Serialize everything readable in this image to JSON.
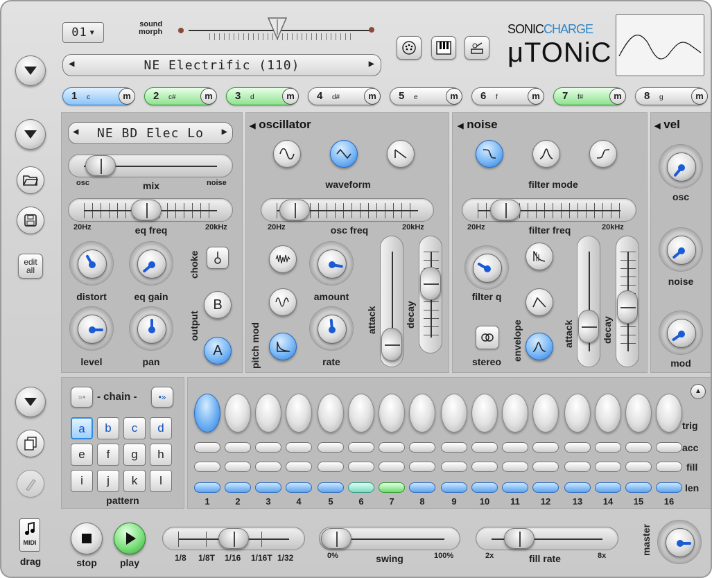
{
  "header": {
    "program": "01",
    "sound_morph": "sound\nmorph",
    "preset": "NE Electrific (110)",
    "brand_top": "SONICCHARGE",
    "brand_sonic": "SONIC",
    "brand_charge": "CHARGE",
    "brand_main": "μTONiC"
  },
  "channels": [
    {
      "num": "1",
      "note": "c",
      "state": "blue"
    },
    {
      "num": "2",
      "note": "c#",
      "state": "green"
    },
    {
      "num": "3",
      "note": "d",
      "state": "green"
    },
    {
      "num": "4",
      "note": "d#",
      "state": "off"
    },
    {
      "num": "5",
      "note": "e",
      "state": "off"
    },
    {
      "num": "6",
      "note": "f",
      "state": "off"
    },
    {
      "num": "7",
      "note": "f#",
      "state": "green"
    },
    {
      "num": "8",
      "note": "g",
      "state": "off"
    }
  ],
  "mute_label": "m",
  "patch": {
    "name": "NE BD Elec Lo",
    "osc": "osc",
    "mix": "mix",
    "noise": "noise",
    "f20": "20Hz",
    "eq_freq": "eq freq",
    "f20k": "20kHz",
    "distort": "distort",
    "eq_gain": "eq gain",
    "choke": "choke",
    "level": "level",
    "pan": "pan",
    "output": "output",
    "out_b": "B",
    "out_a": "A",
    "edit_all": "edit\nall"
  },
  "oscillator": {
    "title": "oscillator",
    "waveform": "waveform",
    "f20": "20Hz",
    "osc_freq": "osc freq",
    "f20k": "20kHz",
    "pitch_mod": "pitch mod",
    "amount": "amount",
    "rate": "rate",
    "attack": "attack",
    "decay": "decay"
  },
  "noise": {
    "title": "noise",
    "filter_mode": "filter mode",
    "f20": "20Hz",
    "filter_freq": "filter freq",
    "f20k": "20kHz",
    "filter_q": "filter q",
    "envelope": "envelope",
    "stereo": "stereo",
    "attack": "attack",
    "decay": "decay"
  },
  "vel": {
    "title": "vel",
    "osc": "osc",
    "noise": "noise",
    "mod": "mod"
  },
  "pattern": {
    "chain": "- chain -",
    "label": "pattern",
    "letters": [
      "a",
      "b",
      "c",
      "d",
      "e",
      "f",
      "g",
      "h",
      "i",
      "j",
      "k",
      "l"
    ],
    "selected": "a"
  },
  "steps": {
    "numbers": [
      "1",
      "2",
      "3",
      "4",
      "5",
      "6",
      "7",
      "8",
      "9",
      "10",
      "11",
      "12",
      "13",
      "14",
      "15",
      "16"
    ],
    "trig": "trig",
    "acc": "acc",
    "fill": "fill",
    "len": "len"
  },
  "transport": {
    "midi": "MIDI",
    "drag": "drag",
    "stop": "stop",
    "play": "play",
    "rates": [
      "1/8",
      "1/8T",
      "1/16",
      "1/16T",
      "1/32"
    ],
    "swing_min": "0%",
    "swing": "swing",
    "swing_max": "100%",
    "fill_min": "2x",
    "fill_rate": "fill rate",
    "fill_max": "8x",
    "master": "master"
  }
}
